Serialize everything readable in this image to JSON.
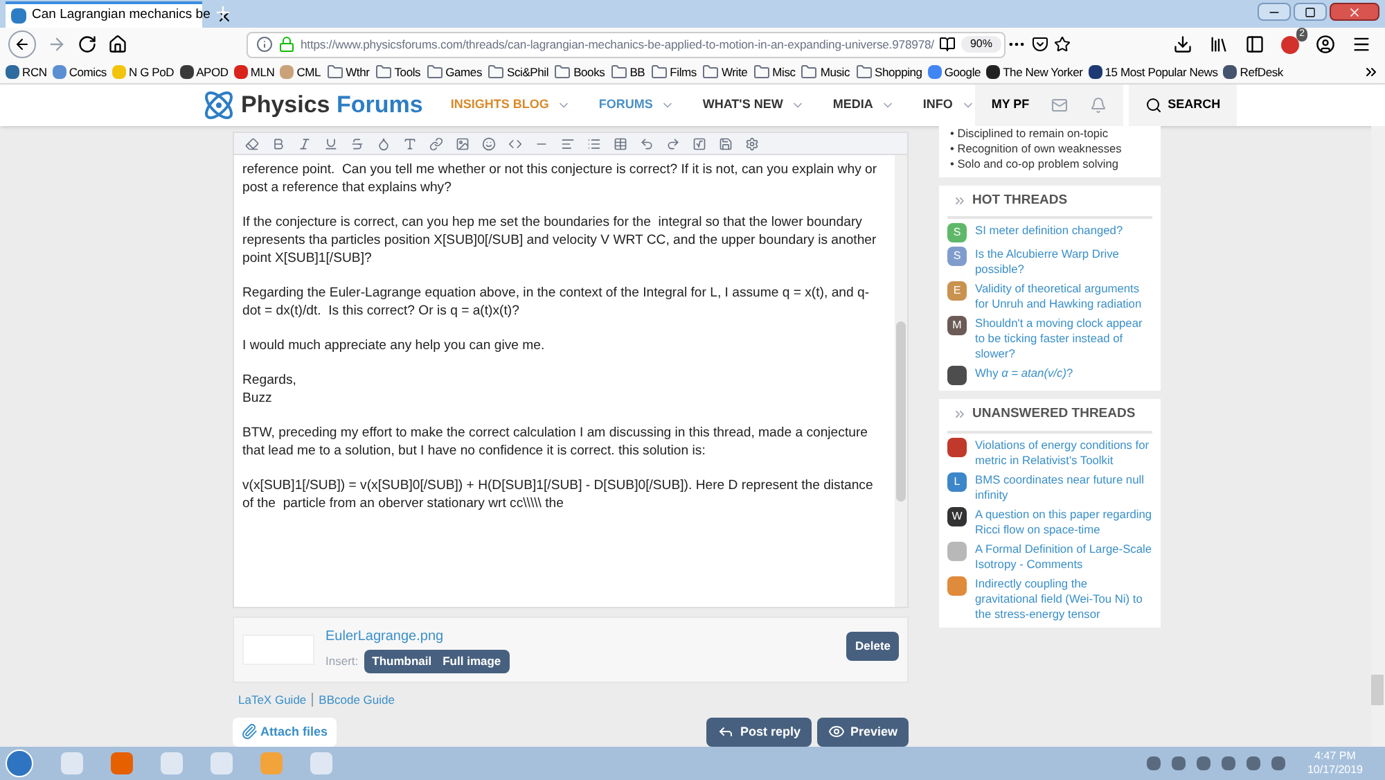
{
  "browser": {
    "tab_title": "Can Lagrangian mechanics be",
    "url": "https://www.physicsforums.com/threads/can-lagrangian-mechanics-be-applied-to-motion-in-an-expanding-universe.978978/",
    "zoom": "90%",
    "extension_badge": "2"
  },
  "bookmarks": [
    {
      "label": "RCN",
      "kind": "site",
      "color": "#2e6b9e"
    },
    {
      "label": "Comics",
      "kind": "site",
      "color": "#5b8fd1"
    },
    {
      "label": "N G PoD",
      "kind": "site",
      "color": "#f2c40c"
    },
    {
      "label": "APOD",
      "kind": "site",
      "color": "#3a3a3a"
    },
    {
      "label": "MLN",
      "kind": "site",
      "color": "#d9241c"
    },
    {
      "label": "CML",
      "kind": "site",
      "color": "#c9a27a"
    },
    {
      "label": "Wthr",
      "kind": "folder"
    },
    {
      "label": "Tools",
      "kind": "folder"
    },
    {
      "label": "Games",
      "kind": "folder"
    },
    {
      "label": "Sci&Phil",
      "kind": "folder"
    },
    {
      "label": "Books",
      "kind": "folder"
    },
    {
      "label": "BB",
      "kind": "folder"
    },
    {
      "label": "Films",
      "kind": "folder"
    },
    {
      "label": "Write",
      "kind": "folder"
    },
    {
      "label": "Misc",
      "kind": "folder"
    },
    {
      "label": "Music",
      "kind": "folder"
    },
    {
      "label": "Shopping",
      "kind": "folder"
    },
    {
      "label": "Google",
      "kind": "site",
      "color": "#4285f4"
    },
    {
      "label": "The New Yorker",
      "kind": "site",
      "color": "#222222"
    },
    {
      "label": "15 Most Popular News",
      "kind": "site",
      "color": "#1d3a74"
    },
    {
      "label": "RefDesk",
      "kind": "site",
      "color": "#44546c"
    }
  ],
  "site": {
    "logo_dark": "Physics",
    "logo_accent": "Forums",
    "nav": [
      {
        "label": "INSIGHTS BLOG",
        "color": "#d98a2b"
      },
      {
        "label": "FORUMS",
        "color": "#4a90c8"
      },
      {
        "label": "WHAT'S NEW",
        "color": "#333333"
      },
      {
        "label": "MEDIA",
        "color": "#333333"
      },
      {
        "label": "INFO",
        "color": "#333333"
      }
    ],
    "my_pf": "MY PF",
    "search": "SEARCH"
  },
  "editor": {
    "paragraphs": [
      "reference point.  Can you tell me whether or not this conjecture is correct? If it is not, can you explain why or post a reference that explains why?",
      "If the conjecture is correct, can you hep me set the boundaries for the  integral so that the lower boundary represents tha particles position X[SUB]0[/SUB] and velocity V WRT CC, and the upper boundary is another point X[SUB]1[/SUB]?",
      "Regarding the Euler-Lagrange equation above, in the context of the Integral for L, I assume q = x(t), and q-dot = dx(t)/dt.  Is this correct? Or is q = a(t)x(t)?",
      "I would much appreciate any help you can give me.",
      "Regards,\nBuzz",
      "BTW, preceding my effort to make the correct calculation I am discussing in this thread, made a conjecture that lead me to a solution, but I have no confidence it is correct. this solution is:",
      "v(x[SUB]1[/SUB]) = v(x[SUB]0[/SUB]) + H(D[SUB]1[/SUB] - D[SUB]0[/SUB]). Here D represent the distance of the  particle from an oberver stationary wrt cc\\\\\\\\\\ the"
    ],
    "attachment": {
      "filename": "EulerLagrange.png",
      "insert_label": "Insert:",
      "insert_options": [
        "Thumbnail",
        "Full image"
      ],
      "delete": "Delete"
    },
    "guides": [
      "LaTeX Guide",
      "BBcode Guide"
    ],
    "attach_files": "Attach files",
    "post_reply": "Post reply",
    "preview": "Preview"
  },
  "sidebar": {
    "bullets": [
      "• Disciplined to remain on-topic",
      "• Recognition of own weaknesses",
      "• Solo and co-op problem solving"
    ],
    "hot_threads": {
      "title": "HOT THREADS",
      "items": [
        {
          "title": "SI meter definition changed?",
          "initial": "S",
          "color": "#5fb86a"
        },
        {
          "title": "Is the Alcubierre Warp Drive possible?",
          "initial": "S",
          "color": "#7f9ccc"
        },
        {
          "title": "Validity of theoretical arguments for Unruh and Hawking radiation",
          "initial": "E",
          "color": "#c9924e"
        },
        {
          "title": "Shouldn't a moving clock appear to be ticking faster instead of slower?",
          "initial": "M",
          "color": "#6b5a55"
        },
        {
          "title": "Why *α = atan(v/c)*?",
          "color": "#4d4d4d"
        }
      ]
    },
    "unanswered_threads": {
      "title": "UNANSWERED THREADS",
      "items": [
        {
          "title": "Violations of energy conditions for metric in Relativist's Toolkit",
          "color": "#c0392b"
        },
        {
          "title": "BMS coordinates near future null infinity",
          "initial": "L",
          "color": "#3d86c9"
        },
        {
          "title": "A question on this paper regarding Ricci flow on space-time",
          "initial": "W",
          "color": "#333333"
        },
        {
          "title": "A Formal Definition of Large-Scale Isotropy - Comments",
          "color": "#b8b8b8"
        },
        {
          "title": "Indirectly coupling the gravitational field (Wei-Tou Ni) to the stress-energy tensor",
          "color": "#e08a3c"
        }
      ]
    }
  },
  "taskbar": {
    "time": "4:47 PM",
    "date": "10/17/2019"
  }
}
